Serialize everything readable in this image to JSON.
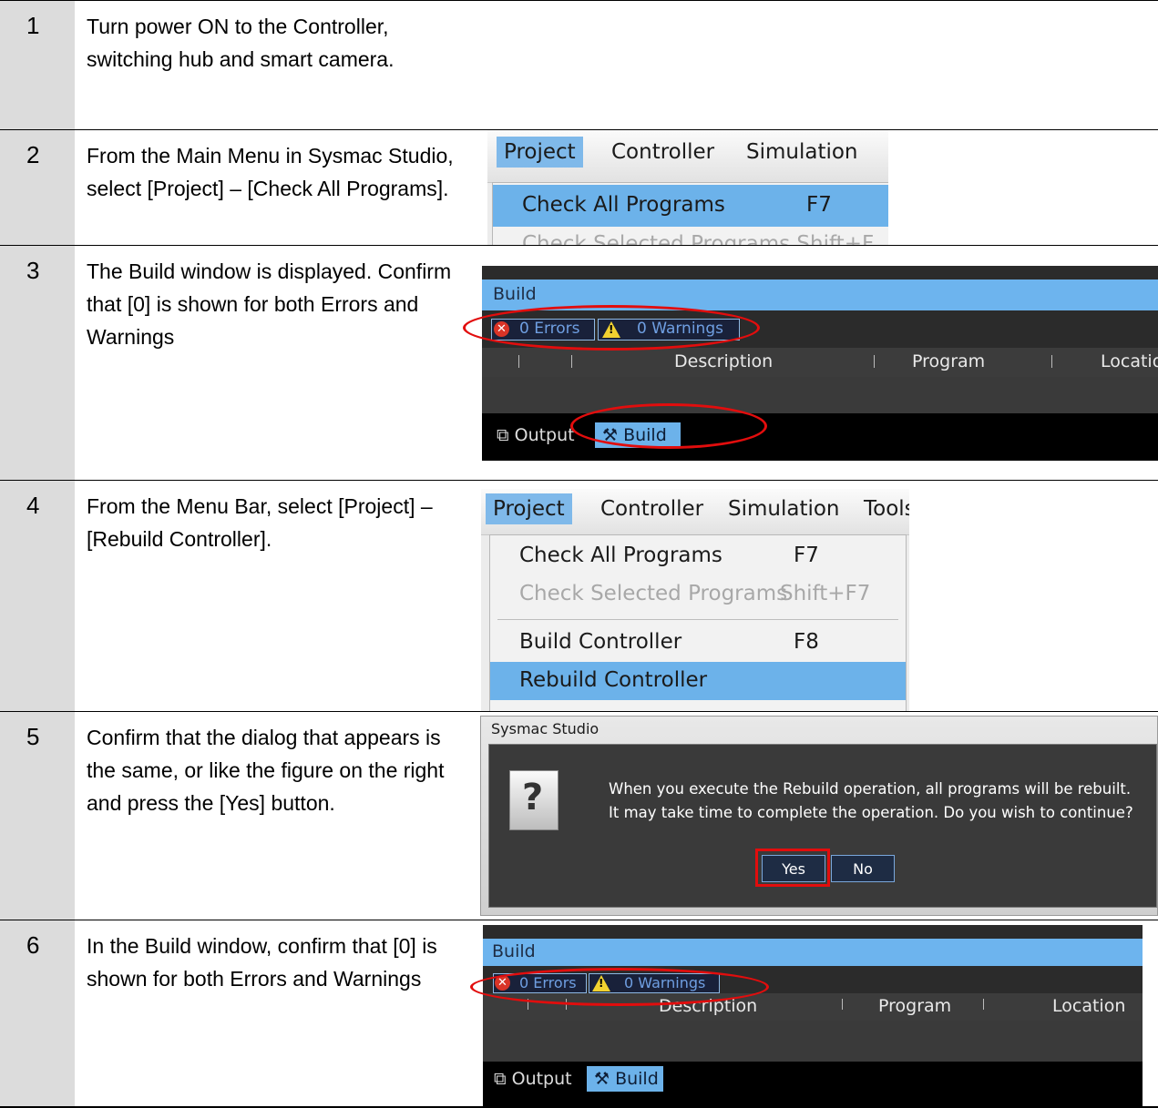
{
  "steps": [
    {
      "num": "1",
      "text": "Turn power ON to the Controller, switching hub and smart camera."
    },
    {
      "num": "2",
      "text": "From the Main Menu in Sysmac Studio, select [Project] – [Check All Programs]."
    },
    {
      "num": "3",
      "text": "The Build window is displayed. Confirm that [0] is shown for both Errors and Warnings"
    },
    {
      "num": "4",
      "text": "From the Menu Bar, select [Project] – [Rebuild Controller]."
    },
    {
      "num": "5",
      "text": "Confirm that the dialog that appears is the same, or like the figure on the right and press the [Yes] button."
    },
    {
      "num": "6",
      "text": "In the Build window, confirm that [0] is shown for both Errors and Warnings"
    }
  ],
  "menu1": {
    "items": [
      "Project",
      "Controller",
      "Simulation"
    ],
    "dropdown": [
      {
        "label": "Check All Programs",
        "key": "F7"
      },
      {
        "label": "Check Selected Programs Shift+F"
      }
    ]
  },
  "build1": {
    "title": "Build",
    "errors": "0  Errors",
    "warnings": "0  Warnings",
    "columns": [
      "Description",
      "Program",
      "Locatio"
    ],
    "tabs": [
      "Output",
      "Build"
    ]
  },
  "menu2": {
    "items": [
      "Project",
      "Controller",
      "Simulation",
      "Tools"
    ],
    "dropdown": [
      {
        "label": "Check All Programs",
        "key": "F7"
      },
      {
        "label": "Check Selected Programs",
        "key": "Shift+F7"
      },
      {
        "label": "Build Controller",
        "key": "F8"
      },
      {
        "label": "Rebuild Controller"
      }
    ]
  },
  "dialog": {
    "title": "Sysmac Studio",
    "message_line1": "When you execute the Rebuild operation, all programs will be rebuilt.",
    "message_line2": "It may take time to complete the operation. Do you wish to continue?",
    "yes": "Yes",
    "no": "No"
  },
  "build2": {
    "title": "Build",
    "errors": "0  Errors",
    "warnings": "0  Warnings",
    "columns": [
      "Description",
      "Program",
      "Location"
    ],
    "tabs": [
      "Output",
      "Build"
    ]
  },
  "colors": {
    "step_number_bg": "#dcdcdc",
    "highlight_blue": "#6cb2ea",
    "annotation_red": "#e20d0d",
    "build_bg": "#2b2b2b"
  }
}
